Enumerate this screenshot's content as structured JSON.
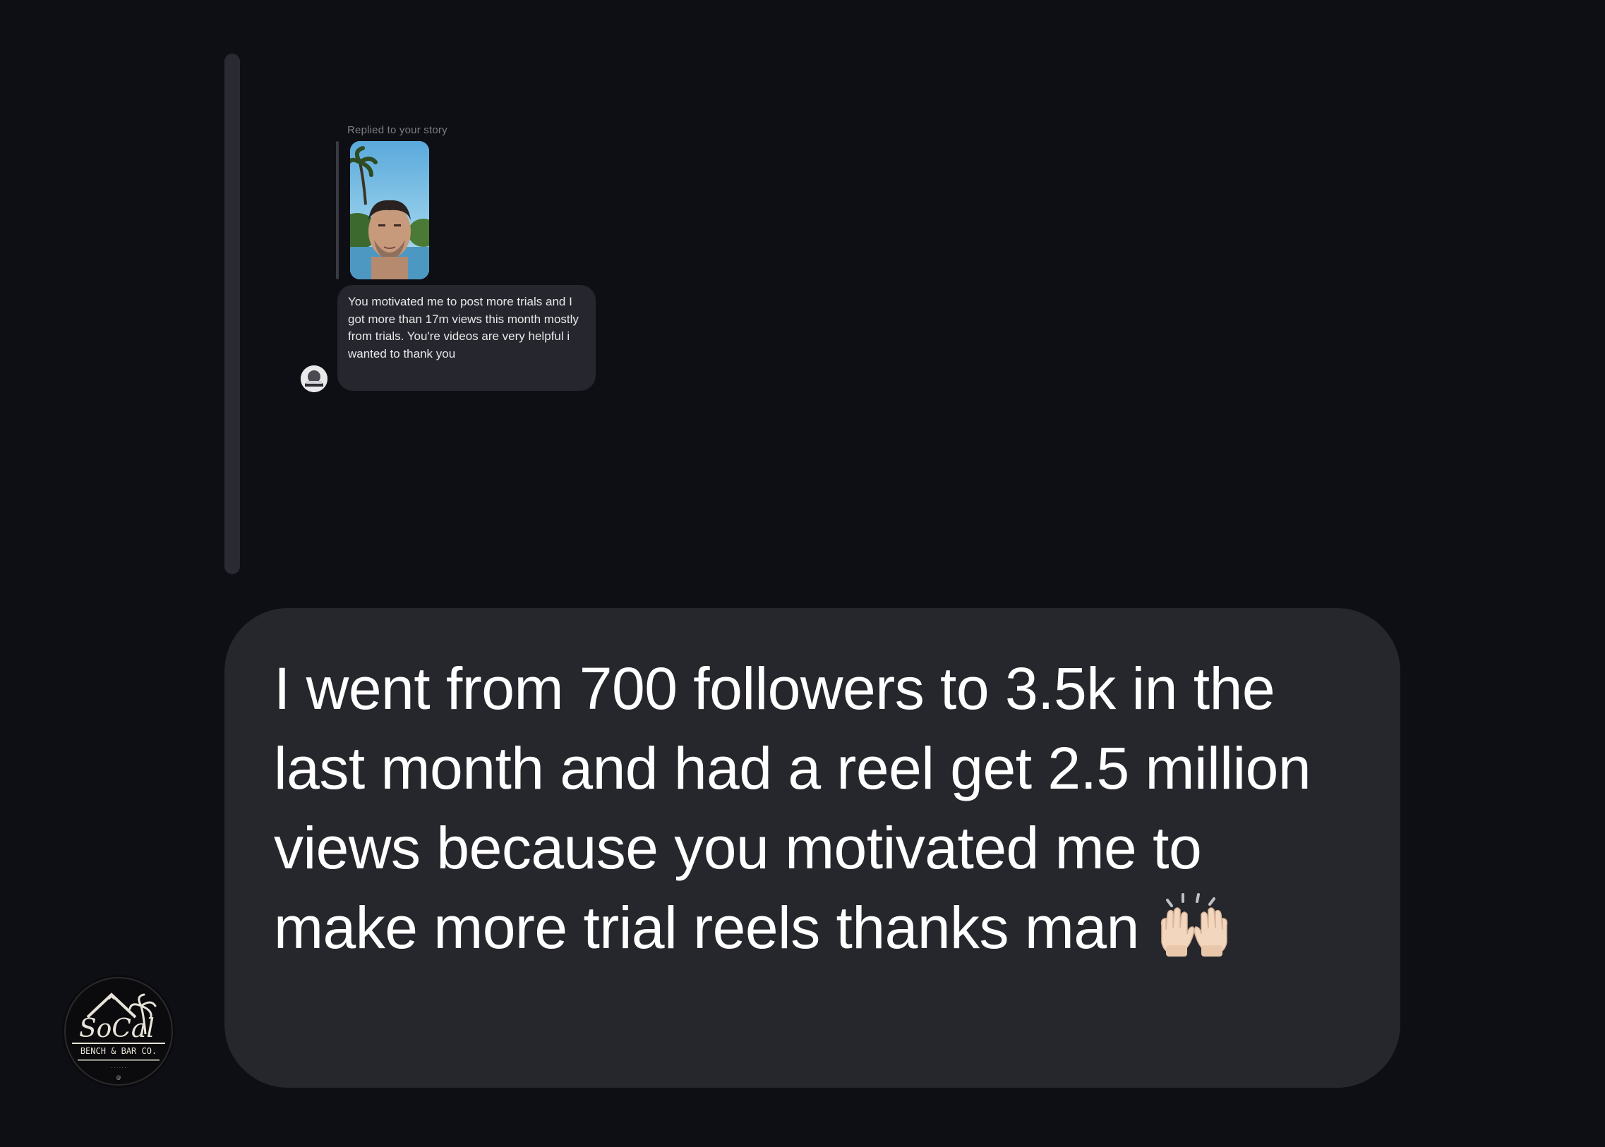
{
  "story_reply": {
    "label": "Replied to your story",
    "message": "You motivated me to post more trials and I got more than 17m views this month mostly from trials. You're videos are very helpful i wanted to thank you"
  },
  "main_message": {
    "text": "I went from 700 followers to 3.5k in the last month and had a reel get 2.5 million views because you motivated me to make more trial reels thanks man",
    "emoji_icon": "raising-hands-icon"
  },
  "avatar": {
    "brand_text": "SoCal",
    "sub_text": "BENCH & BAR CO."
  },
  "colors": {
    "background": "#0e0f14",
    "bubble": "#26272d",
    "text": "#ffffff"
  }
}
